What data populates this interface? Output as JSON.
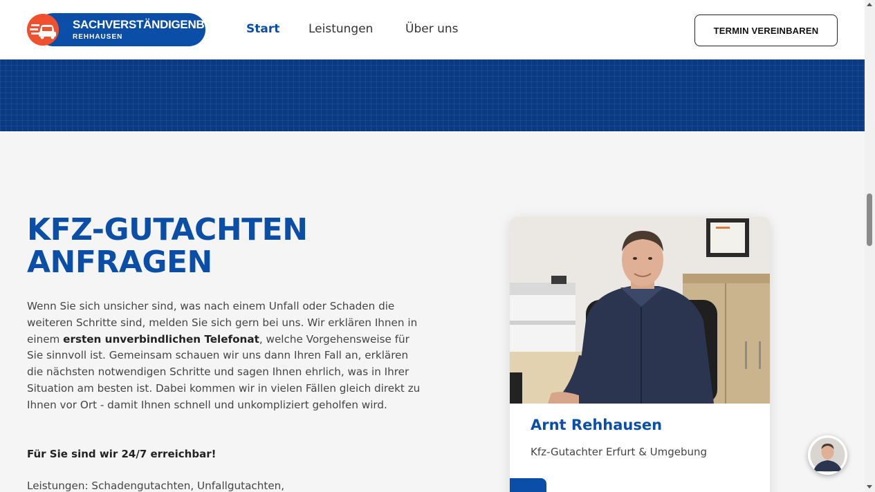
{
  "header": {
    "logo": {
      "line1": "SACHVERSTÄNDIGENBÜRO",
      "line2": "REHHAUSEN"
    },
    "nav": [
      {
        "label": "Start",
        "active": true
      },
      {
        "label": "Leistungen",
        "active": false
      },
      {
        "label": "Über uns",
        "active": false
      }
    ],
    "cta_label": "TERMIN VEREINBAREN"
  },
  "main": {
    "headline_line1": "KFZ-GUTACHTEN",
    "headline_line2": "ANFRAGEN",
    "body_part1": "Wenn Sie sich unsicher sind, was nach einem Unfall oder Schaden die weiteren Schritte sind, melden Sie sich gern bei uns. Wir erklären Ihnen in einem ",
    "body_bold": "ersten unverbindlichen Telefonat",
    "body_part2": ", welche Vorgehensweise für Sie sinnvoll ist. Gemeinsam schauen wir uns dann Ihren Fall an, erklären die nächsten notwendigen Schritte und sagen Ihnen ehrlich, was in Ihrer Situation am besten ist. Dabei kommen wir in vielen Fällen gleich direkt zu Ihnen vor Ort - damit Ihnen schnell und unkompliziert geholfen wird.",
    "reachability": "Für Sie sind wir 24/7 erreichbar!",
    "services": "Leistungen: Schadengutachten, Unfallgutachten,"
  },
  "card": {
    "name": "Arnt Rehhausen",
    "role": "Kfz-Gutachter Erfurt & Umgebung"
  },
  "colors": {
    "brand_blue": "#0b4ea8",
    "banner_blue": "#0a3a84",
    "logo_orange": "#f0502d"
  },
  "icons": {
    "logo": "car-logo-icon",
    "chat": "chat-avatar-icon"
  }
}
